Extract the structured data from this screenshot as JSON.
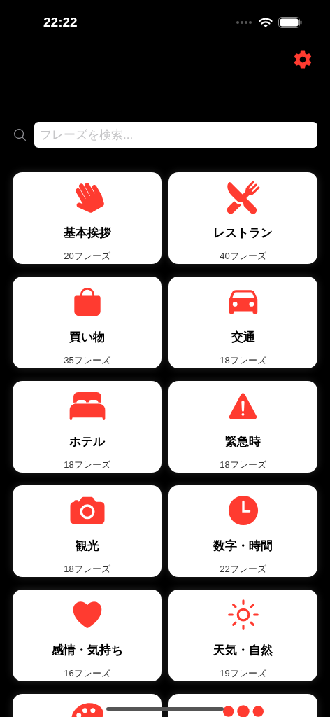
{
  "status_bar": {
    "time": "22:22"
  },
  "search": {
    "placeholder": "フレーズを検索..."
  },
  "categories": [
    {
      "kind": "hand",
      "title": "基本挨拶",
      "count": "20フレーズ"
    },
    {
      "kind": "restaurant",
      "title": "レストラン",
      "count": "40フレーズ"
    },
    {
      "kind": "bag",
      "title": "買い物",
      "count": "35フレーズ"
    },
    {
      "kind": "car",
      "title": "交通",
      "count": "18フレーズ"
    },
    {
      "kind": "bed",
      "title": "ホテル",
      "count": "18フレーズ"
    },
    {
      "kind": "warning",
      "title": "緊急時",
      "count": "18フレーズ"
    },
    {
      "kind": "camera",
      "title": "観光",
      "count": "18フレーズ"
    },
    {
      "kind": "clock",
      "title": "数字・時間",
      "count": "22フレーズ"
    },
    {
      "kind": "heart",
      "title": "感情・気持ち",
      "count": "16フレーズ"
    },
    {
      "kind": "sun",
      "title": "天気・自然",
      "count": "19フレーズ"
    },
    {
      "kind": "palette"
    },
    {
      "kind": "dots"
    }
  ]
}
